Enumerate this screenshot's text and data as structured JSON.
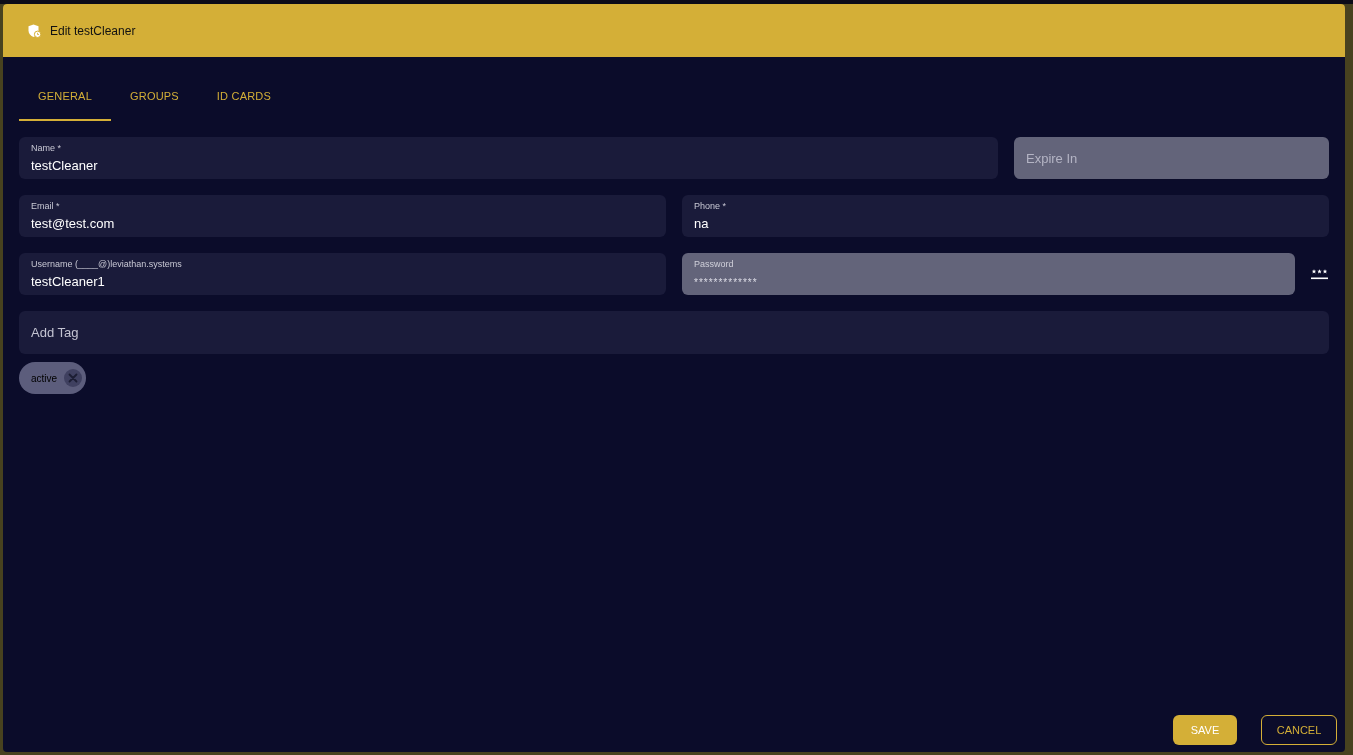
{
  "dialog": {
    "title": "Edit testCleaner"
  },
  "tabs": [
    {
      "label": "GENERAL",
      "selected": true
    },
    {
      "label": "GROUPS",
      "selected": false
    },
    {
      "label": "ID CARDS",
      "selected": false
    }
  ],
  "form_rows": [
    {
      "kind": "main-side",
      "fields": [
        {
          "kind": "text",
          "label": "Name *",
          "value": "testCleaner",
          "disabled": false
        },
        {
          "kind": "text",
          "placeholder": "Expire In",
          "disabled": true
        }
      ]
    },
    {
      "kind": "split",
      "fields": [
        {
          "kind": "text",
          "label": "Email *",
          "value": "test@test.com",
          "disabled": false
        },
        {
          "kind": "text",
          "label": "Phone *",
          "value": "na",
          "disabled": false
        }
      ]
    },
    {
      "kind": "split",
      "fields": [
        {
          "kind": "text",
          "label": "Username (____@)leviathan.systems",
          "value": "testCleaner1",
          "disabled": false
        },
        {
          "kind": "password",
          "label": "Password",
          "value": "*************",
          "disabled": true
        }
      ]
    },
    {
      "kind": "full",
      "fields": [
        {
          "kind": "text",
          "placeholder": "Add Tag",
          "disabled": false
        }
      ]
    }
  ],
  "tags": [
    {
      "label": "active"
    }
  ],
  "buttons": [
    {
      "label": "SAVE",
      "kind": "primary"
    },
    {
      "label": "CANCEL",
      "kind": "outlined"
    }
  ]
}
